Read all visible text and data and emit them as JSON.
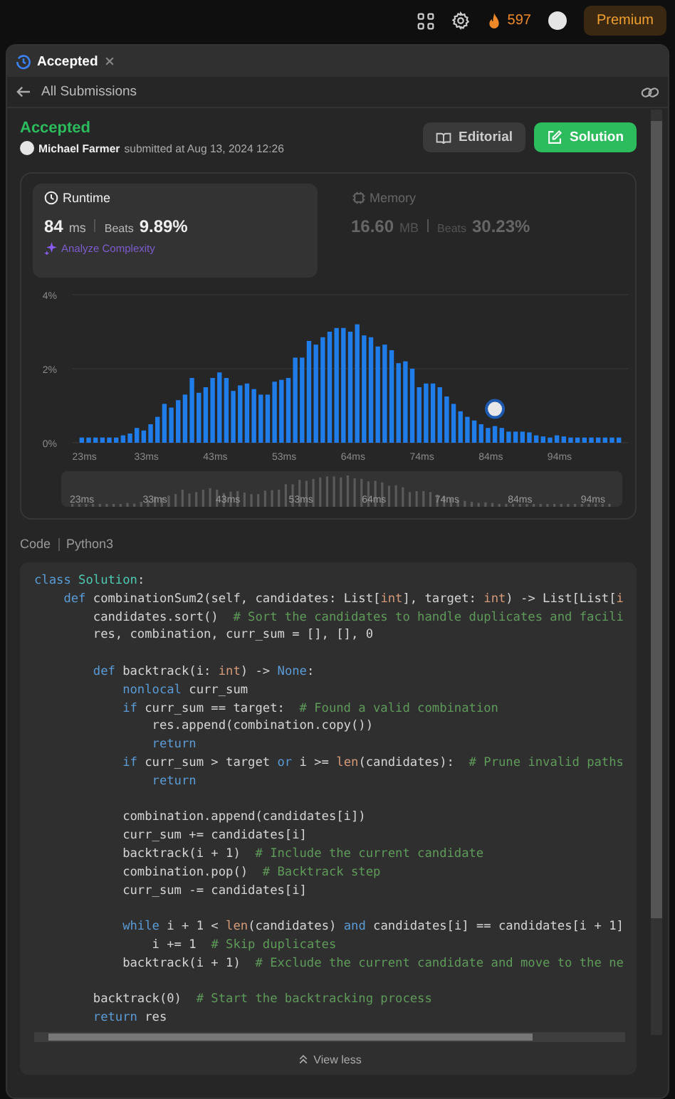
{
  "topbar": {
    "streak": "597",
    "premium": "Premium"
  },
  "tab": {
    "label": "Accepted",
    "selected": true
  },
  "back_link": "All Submissions",
  "submission": {
    "status": "Accepted",
    "author": "Michael Farmer",
    "submitted": "submitted at Aug 13, 2024 12:26"
  },
  "buttons": [
    {
      "label": "Editorial",
      "kind": "secondary"
    },
    {
      "label": "Solution",
      "kind": "primary"
    }
  ],
  "stats": [
    {
      "kind": "runtime",
      "label": "Runtime",
      "value": "84",
      "unit": "ms",
      "beats_label": "Beats",
      "beats": "9.89%",
      "selected": true,
      "action": "Analyze Complexity"
    },
    {
      "kind": "memory",
      "label": "Memory",
      "value": "16.60",
      "unit": "MB",
      "beats_label": "Beats",
      "beats": "30.23%",
      "selected": false
    }
  ],
  "chart_data": {
    "type": "bar",
    "ylim": [
      0,
      4
    ],
    "yticks": [
      {
        "value": 0,
        "label": "0%"
      },
      {
        "value": 2,
        "label": "2%"
      },
      {
        "value": 4,
        "label": "4%"
      }
    ],
    "categories": [
      "23ms",
      null,
      null,
      null,
      null,
      null,
      null,
      null,
      null,
      "33ms",
      null,
      null,
      null,
      null,
      null,
      null,
      null,
      null,
      null,
      "43ms",
      null,
      null,
      null,
      null,
      null,
      null,
      null,
      null,
      null,
      "53ms",
      null,
      null,
      null,
      null,
      null,
      null,
      null,
      null,
      null,
      "64ms",
      null,
      null,
      null,
      null,
      null,
      null,
      null,
      null,
      null,
      "74ms",
      null,
      null,
      null,
      null,
      null,
      null,
      null,
      null,
      null,
      "84ms",
      null,
      null,
      null,
      null,
      null,
      null,
      null,
      null,
      null,
      "94ms",
      null,
      null,
      null,
      null,
      null,
      null,
      null,
      null,
      null
    ],
    "series": [
      {
        "color": "#1f7ce8",
        "values": [
          0.14,
          0.14,
          0.14,
          0.14,
          0.14,
          0.14,
          0.2,
          0.25,
          0.4,
          0.33,
          0.5,
          0.7,
          1.05,
          0.95,
          1.15,
          1.3,
          1.75,
          1.35,
          1.5,
          1.75,
          1.9,
          1.75,
          1.4,
          1.55,
          1.6,
          1.45,
          1.3,
          1.3,
          1.65,
          1.7,
          1.75,
          2.3,
          2.3,
          2.75,
          2.65,
          2.85,
          3.0,
          3.1,
          3.1,
          3.0,
          3.2,
          2.9,
          2.85,
          2.6,
          2.65,
          2.5,
          2.15,
          2.2,
          2.0,
          1.5,
          1.6,
          1.6,
          1.5,
          1.25,
          1.05,
          0.85,
          0.7,
          0.6,
          0.5,
          0.4,
          0.45,
          0.4,
          0.3,
          0.3,
          0.3,
          0.28,
          0.2,
          0.17,
          0.14,
          0.2,
          0.17,
          0.14,
          0.14,
          0.14,
          0.14,
          0.14,
          0.14,
          0.14,
          0.14
        ]
      }
    ],
    "annotations": [
      {
        "x": "84ms"
      }
    ]
  },
  "overview": {
    "labels": [
      "23ms",
      "33ms",
      "43ms",
      "53ms",
      "64ms",
      "74ms",
      "84ms",
      "94ms"
    ]
  },
  "code": {
    "label": "Code",
    "language": "Python3",
    "toggle": "View less",
    "lines": [
      {
        "tokens": [
          {
            "text": "class ",
            "kind": "keyword"
          },
          {
            "text": "Solution",
            "kind": "class"
          },
          {
            "text": ":"
          }
        ]
      },
      {
        "tokens": [
          {
            "text": "    def ",
            "kind": "keyword"
          },
          {
            "text": "combinationSum2(self, candidates: List["
          },
          {
            "text": "int",
            "kind": "type"
          },
          {
            "text": "], target: "
          },
          {
            "text": "int",
            "kind": "type"
          },
          {
            "text": ") -> List[List["
          },
          {
            "text": "i",
            "kind": "type"
          }
        ]
      },
      {
        "tokens": [
          {
            "text": "        candidates.sort()  "
          },
          {
            "text": "# Sort the candidates to handle duplicates and facili",
            "kind": "comment"
          }
        ]
      },
      {
        "tokens": [
          {
            "text": "        res, combination, curr_sum = [], [], 0"
          }
        ]
      },
      {
        "gap_before": true,
        "tokens": [
          {
            "text": "        def ",
            "kind": "keyword"
          },
          {
            "text": "backtrack(i: "
          },
          {
            "text": "int",
            "kind": "type"
          },
          {
            "text": ") -> "
          },
          {
            "text": "None",
            "kind": "keyword"
          },
          {
            "text": ":"
          }
        ]
      },
      {
        "tokens": [
          {
            "text": "            nonlocal ",
            "kind": "keyword"
          },
          {
            "text": "curr_sum"
          }
        ]
      },
      {
        "tokens": [
          {
            "text": "            if ",
            "kind": "keyword"
          },
          {
            "text": "curr_sum == target:  "
          },
          {
            "text": "# Found a valid combination",
            "kind": "comment"
          }
        ]
      },
      {
        "tokens": [
          {
            "text": "                res.append(combination.copy())"
          }
        ]
      },
      {
        "tokens": [
          {
            "text": "                return",
            "kind": "keyword"
          }
        ]
      },
      {
        "tokens": [
          {
            "text": "            if ",
            "kind": "keyword"
          },
          {
            "text": "curr_sum > target "
          },
          {
            "text": "or ",
            "kind": "keyword"
          },
          {
            "text": "i >= "
          },
          {
            "text": "len",
            "kind": "type"
          },
          {
            "text": "(candidates):  "
          },
          {
            "text": "# Prune invalid paths",
            "kind": "comment"
          }
        ]
      },
      {
        "tokens": [
          {
            "text": "                return",
            "kind": "keyword"
          }
        ]
      },
      {
        "gap_before": true,
        "tokens": [
          {
            "text": "            combination.append(candidates[i])"
          }
        ]
      },
      {
        "tokens": [
          {
            "text": "            curr_sum += candidates[i]"
          }
        ]
      },
      {
        "tokens": [
          {
            "text": "            backtrack(i + 1)  "
          },
          {
            "text": "# Include the current candidate",
            "kind": "comment"
          }
        ]
      },
      {
        "tokens": [
          {
            "text": "            combination.pop()  "
          },
          {
            "text": "# Backtrack step",
            "kind": "comment"
          }
        ]
      },
      {
        "tokens": [
          {
            "text": "            curr_sum -= candidates[i]"
          }
        ]
      },
      {
        "gap_before": true,
        "tokens": [
          {
            "text": "            while ",
            "kind": "keyword"
          },
          {
            "text": "i + 1 < "
          },
          {
            "text": "len",
            "kind": "type"
          },
          {
            "text": "(candidates) "
          },
          {
            "text": "and ",
            "kind": "keyword"
          },
          {
            "text": "candidates[i] == candidates[i + 1]"
          }
        ]
      },
      {
        "tokens": [
          {
            "text": "                i += 1  "
          },
          {
            "text": "# Skip duplicates",
            "kind": "comment"
          }
        ]
      },
      {
        "tokens": [
          {
            "text": "            backtrack(i + 1)  "
          },
          {
            "text": "# Exclude the current candidate and move to the ne",
            "kind": "comment"
          }
        ]
      },
      {
        "gap_before": true,
        "tokens": [
          {
            "text": "        backtrack(0)  "
          },
          {
            "text": "# Start the backtracking process",
            "kind": "comment"
          }
        ]
      },
      {
        "tokens": [
          {
            "text": "        return ",
            "kind": "keyword"
          },
          {
            "text": "res"
          }
        ]
      }
    ]
  }
}
